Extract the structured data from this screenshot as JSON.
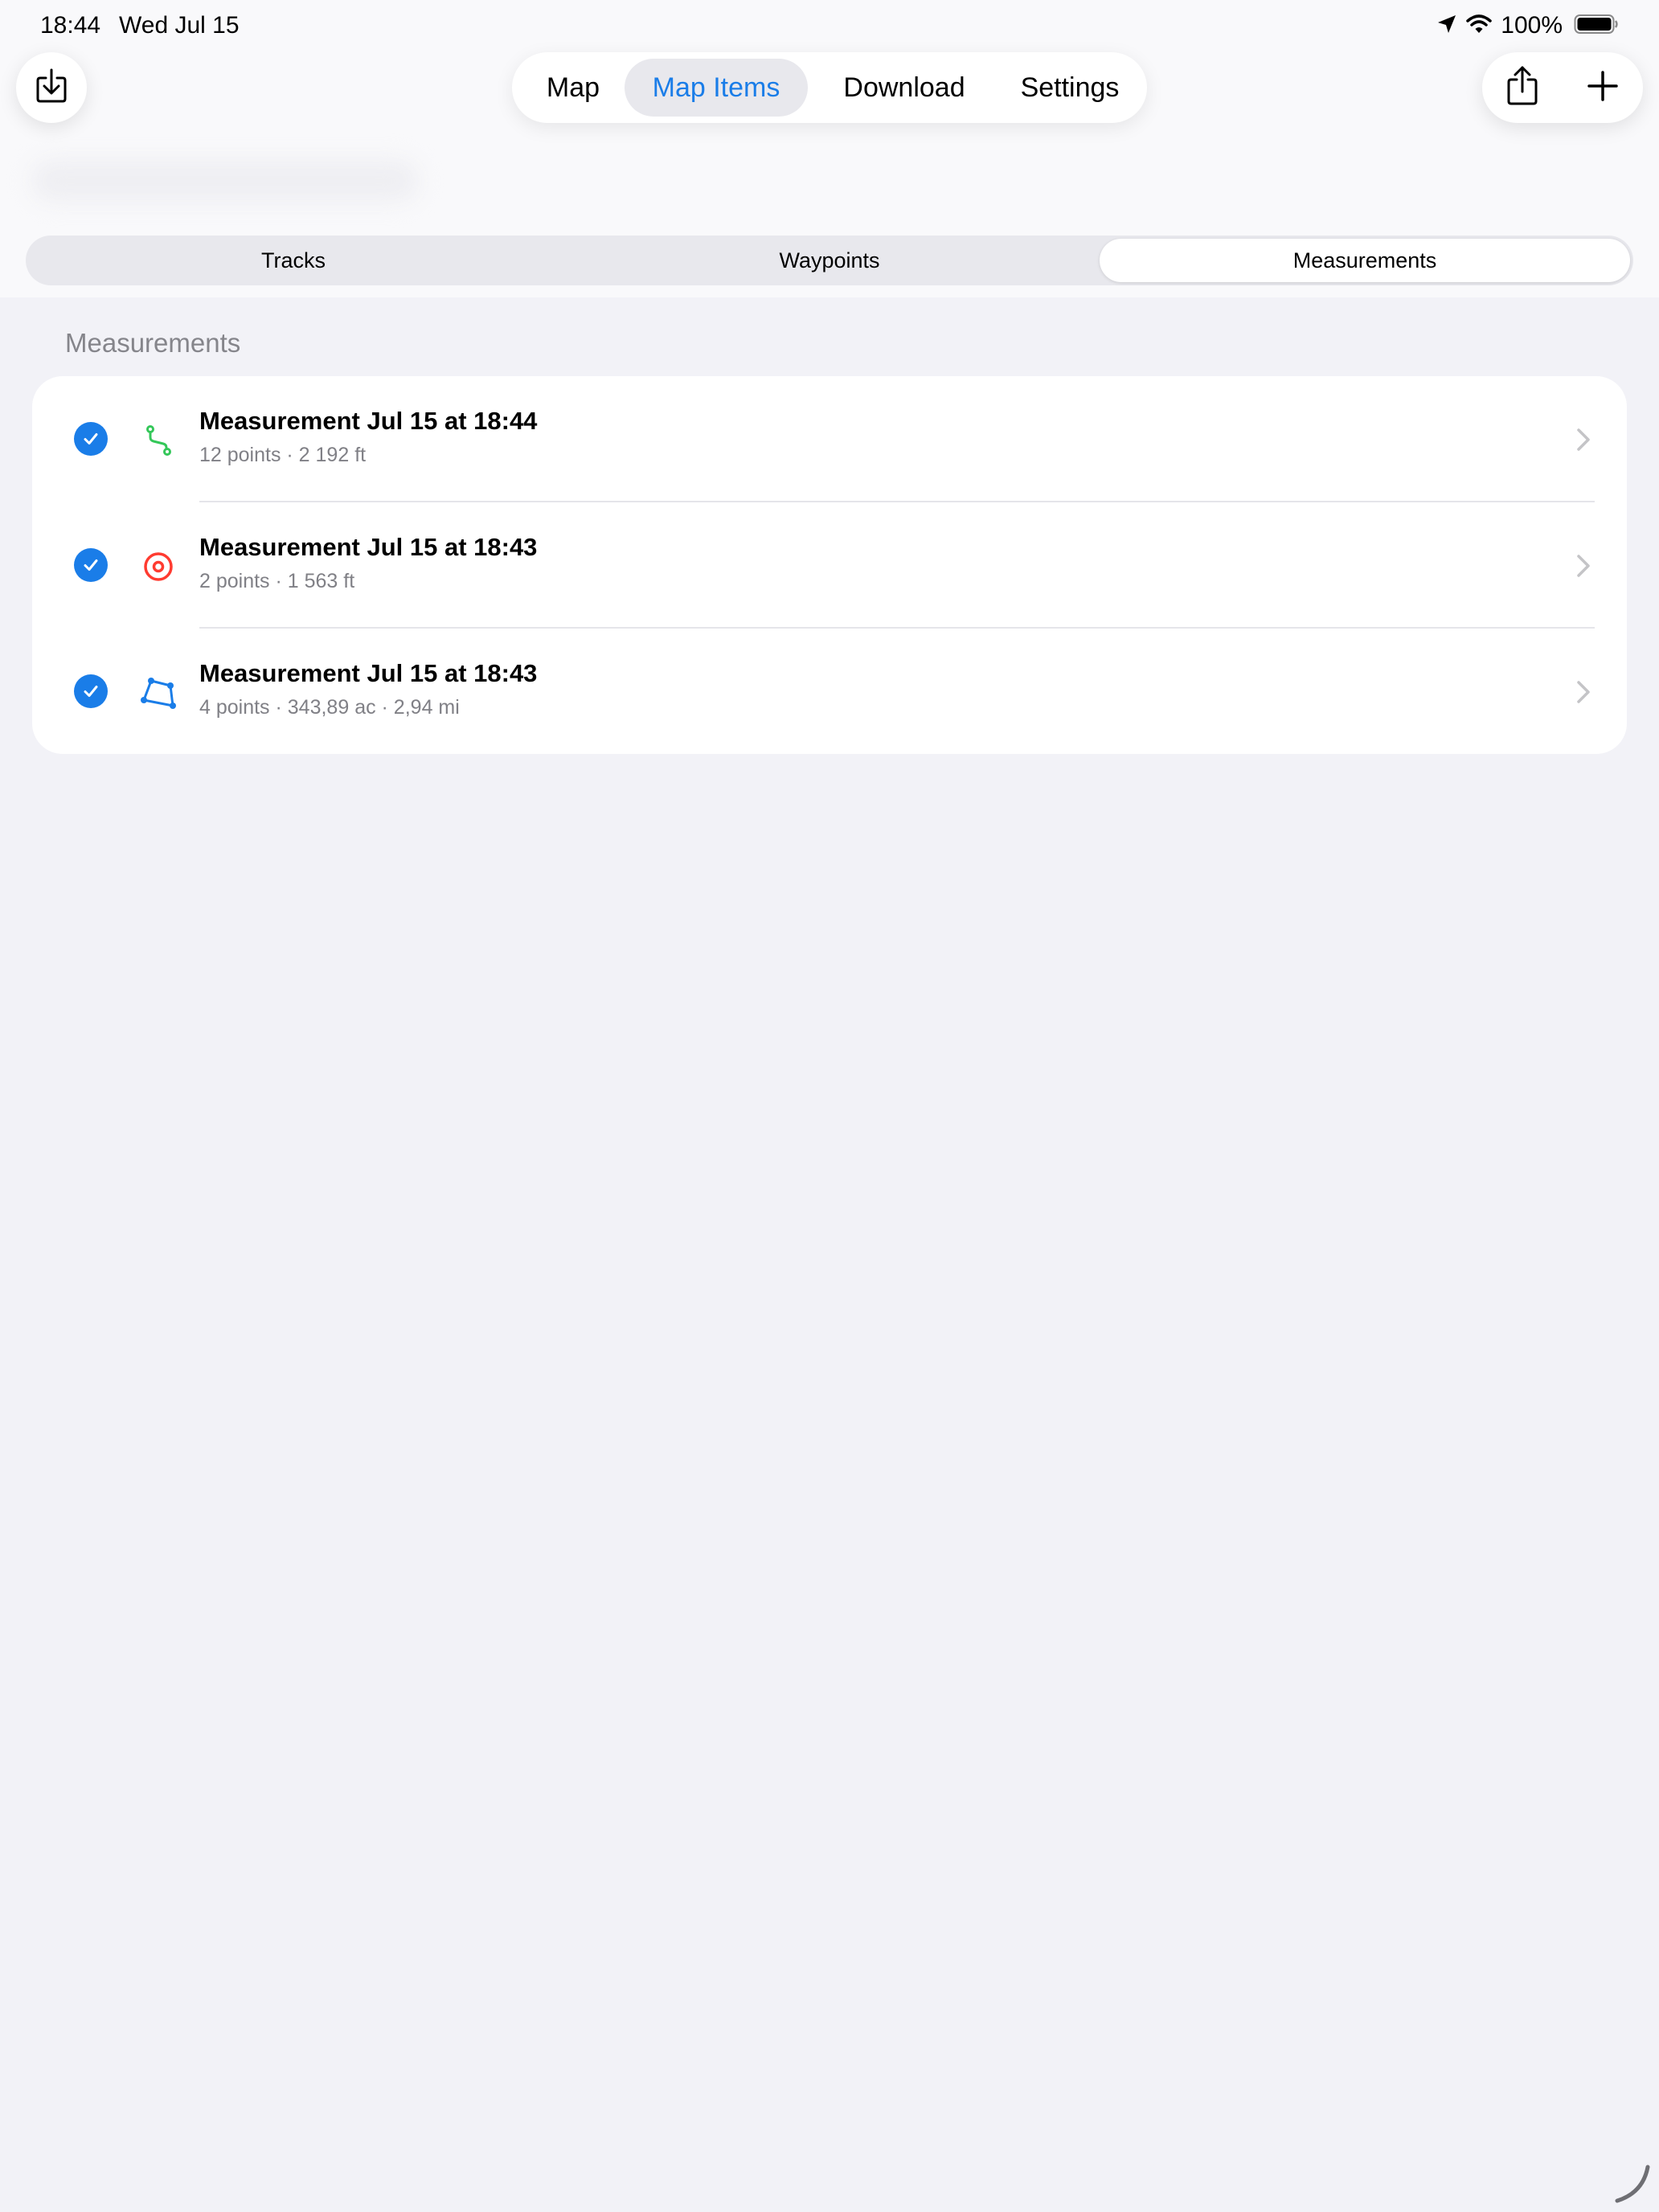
{
  "status_bar": {
    "time": "18:44",
    "date": "Wed Jul 15",
    "battery": "100%"
  },
  "tabs": [
    {
      "label": "Map",
      "active": false
    },
    {
      "label": "Map Items",
      "active": true
    },
    {
      "label": "Download",
      "active": false
    },
    {
      "label": "Settings",
      "active": false
    }
  ],
  "segments": [
    {
      "label": "Tracks",
      "selected": false
    },
    {
      "label": "Waypoints",
      "selected": false
    },
    {
      "label": "Measurements",
      "selected": true
    }
  ],
  "section": {
    "header": "Measurements"
  },
  "measurements": [
    {
      "title": "Measurement Jul 15 at 18:44",
      "subtitle": "12 points · 2 192 ft",
      "icon": "route-icon",
      "icon_color": "#34c759",
      "checked": true
    },
    {
      "title": "Measurement Jul 15 at 18:43",
      "subtitle": "2 points · 1 563 ft",
      "icon": "target-icon",
      "icon_color": "#ff3b30",
      "checked": true
    },
    {
      "title": "Measurement Jul 15 at 18:43",
      "subtitle": "4 points · 343,89 ac · 2,94 mi",
      "icon": "polygon-icon",
      "icon_color": "#1a7de8",
      "checked": true
    }
  ],
  "colors": {
    "accent": "#1a7de8",
    "background": "#f2f2f7",
    "secondary_text": "#808086"
  }
}
